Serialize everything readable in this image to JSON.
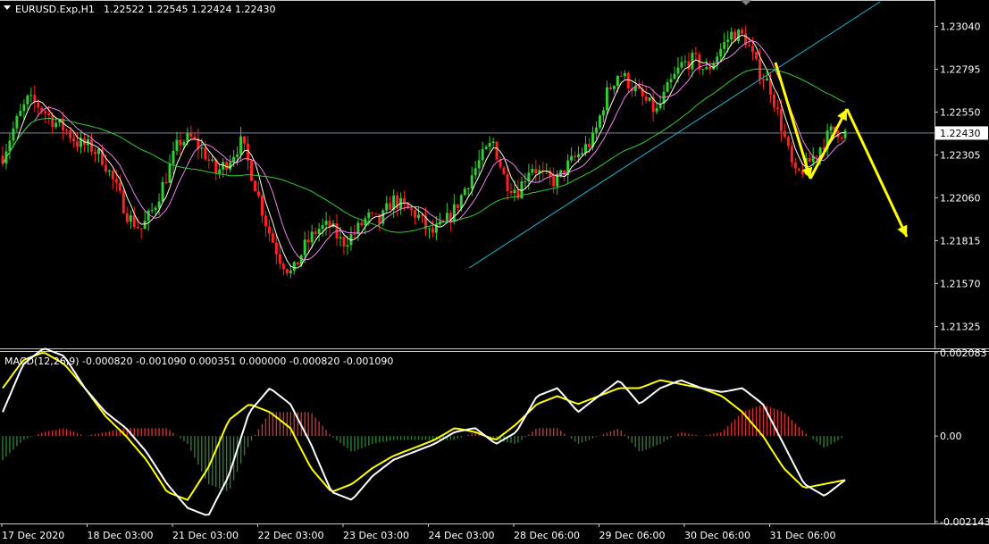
{
  "header": {
    "symbol": "EURUSD.Exp,H1",
    "ohlc": "1.22522 1.22545 1.22424 1.22430"
  },
  "indicator": {
    "label": "MACD(12,26,9) -0.000820 -0.001090 0.000351 0.000000 -0.000820 -0.001090"
  },
  "price_axis": {
    "ticks": [
      "1.23040",
      "1.22795",
      "1.22550",
      "1.22305",
      "1.22060",
      "1.21815",
      "1.21570",
      "1.21325"
    ],
    "current": "1.22430"
  },
  "macd_axis": {
    "ticks": [
      "0.002083",
      "0.00",
      "-0.002143"
    ]
  },
  "time_axis": {
    "ticks": [
      "17 Dec 2020",
      "18 Dec 03:00",
      "21 Dec 03:00",
      "22 Dec 03:00",
      "23 Dec 03:00",
      "24 Dec 03:00",
      "28 Dec 06:00",
      "29 Dec 06:00",
      "30 Dec 06:00",
      "31 Dec 06:00"
    ]
  },
  "colors": {
    "background": "#000000",
    "bull": "#32cd32",
    "bear": "#ff2020",
    "ma_fast": "#ffffe0",
    "ma_mid": "#ee82ee",
    "ma_slow": "#32cd32",
    "trendline": "#22b8dd",
    "arrows": "#ffff00",
    "macd_line": "#ffffff",
    "signal_line": "#ffff00",
    "hist_pos": "#d03030",
    "hist_neg": "#2e7d32"
  },
  "chart_data": [
    {
      "type": "candlestick",
      "symbol": "EURUSD.Exp",
      "timeframe": "H1",
      "ylim": [
        1.2121,
        1.2318
      ],
      "current_price": 1.2243,
      "x": [
        "17 Dec 2020",
        "18 Dec 03:00",
        "21 Dec 03:00",
        "22 Dec 03:00",
        "23 Dec 03:00",
        "24 Dec 03:00",
        "28 Dec 06:00",
        "29 Dec 06:00",
        "30 Dec 06:00",
        "31 Dec 06:00"
      ],
      "close_path": [
        1.223,
        1.2248,
        1.2262,
        1.2258,
        1.225,
        1.2245,
        1.2237,
        1.2235,
        1.2228,
        1.2212,
        1.2195,
        1.2188,
        1.22,
        1.2218,
        1.2238,
        1.224,
        1.2232,
        1.222,
        1.2228,
        1.2238,
        1.2215,
        1.219,
        1.2172,
        1.2162,
        1.2178,
        1.2188,
        1.219,
        1.218,
        1.2186,
        1.2195,
        1.2192,
        1.2205,
        1.22,
        1.2196,
        1.2185,
        1.219,
        1.22,
        1.2215,
        1.2228,
        1.2238,
        1.2215,
        1.221,
        1.2225,
        1.2218,
        1.2215,
        1.2225,
        1.2232,
        1.224,
        1.2265,
        1.2278,
        1.227,
        1.2262,
        1.2255,
        1.227,
        1.2282,
        1.2285,
        1.2278,
        1.229,
        1.23,
        1.2298,
        1.228,
        1.227,
        1.2245,
        1.2218,
        1.2225,
        1.2235,
        1.2245,
        1.2243
      ]
    },
    {
      "type": "line",
      "title": "MACD(12,26,9)",
      "ylim": [
        -0.002143,
        0.002083
      ],
      "values_printed": [
        -0.00082,
        -0.00109,
        0.000351,
        0.0,
        -0.00082,
        -0.00109
      ],
      "series": [
        {
          "values": [
            0.0006,
            0.0018,
            0.0022,
            0.002,
            0.0012,
            0.0006,
            0.0002,
            -0.0004,
            -0.0012,
            -0.0018,
            -0.002,
            -0.001,
            0.0006,
            0.0012,
            0.0008,
            -0.0002,
            -0.0014,
            -0.0016,
            -0.001,
            -0.0006,
            -0.0004,
            -0.0002,
            0.0001,
            0.0002,
            -0.0002,
            0.0001,
            0.001,
            0.0012,
            0.0006,
            0.001,
            0.0014,
            0.0008,
            0.0012,
            0.0014,
            0.0012,
            0.0011,
            0.0012,
            0.0008,
            -0.0002,
            -0.0012,
            -0.0015,
            -0.0011
          ]
        },
        {
          "values": [
            0.0012,
            0.0019,
            0.0021,
            0.0018,
            0.0012,
            0.0005,
            0.0,
            -0.0006,
            -0.0014,
            -0.0016,
            -0.0008,
            0.0004,
            0.0008,
            0.0006,
            0.0002,
            -0.0008,
            -0.0014,
            -0.0012,
            -0.0008,
            -0.0005,
            -0.0003,
            -0.0001,
            0.0002,
            0.0001,
            -0.0001,
            0.0003,
            0.0008,
            0.001,
            0.0008,
            0.001,
            0.0012,
            0.0012,
            0.0014,
            0.0013,
            0.0012,
            0.001,
            0.0006,
            0.0,
            -0.0008,
            -0.0013,
            -0.0012,
            -0.0011
          ]
        }
      ]
    }
  ]
}
